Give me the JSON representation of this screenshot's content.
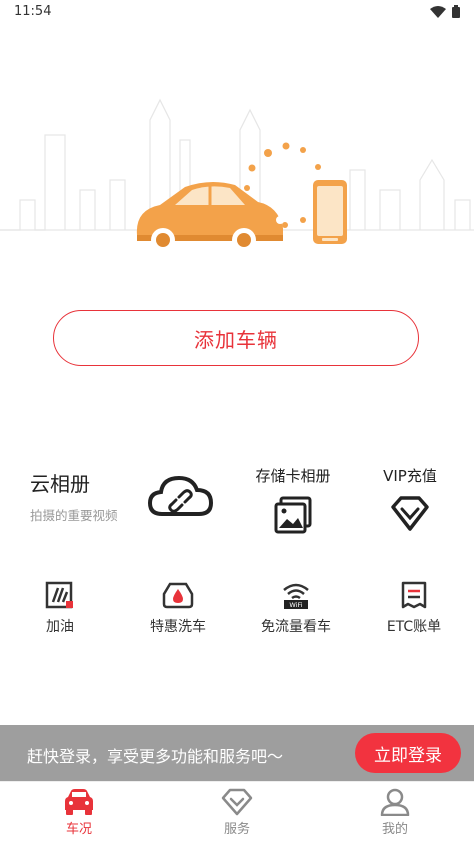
{
  "status_bar": {
    "time": "11:54"
  },
  "hero": {
    "illustration": "car-and-phone-connection"
  },
  "add_car": {
    "label": "添加车辆"
  },
  "cloud_album": {
    "title": "云相册",
    "subtitle": "拍摄的重要视频",
    "icon": "cloud-link-icon"
  },
  "sd_album": {
    "title": "存储卡相册",
    "icon": "photo-gallery-icon"
  },
  "vip": {
    "title": "VIP充值",
    "icon": "diamond-icon"
  },
  "quick_actions": [
    {
      "label": "加油",
      "icon": "fuel-icon"
    },
    {
      "label": "特惠洗车",
      "icon": "car-wash-icon"
    },
    {
      "label": "免流量看车",
      "icon": "wifi-icon"
    },
    {
      "label": "ETC账单",
      "icon": "bill-icon"
    }
  ],
  "login_banner": {
    "text": "赶快登录，享受更多功能和服务吧～",
    "button": "立即登录"
  },
  "tabs": [
    {
      "label": "车况",
      "icon": "car-icon",
      "active": true
    },
    {
      "label": "服务",
      "icon": "diamond-icon",
      "active": false
    },
    {
      "label": "我的",
      "icon": "user-icon",
      "active": false
    }
  ],
  "colors": {
    "accent": "#e8333a",
    "car_orange": "#f3a24a",
    "banner_gray": "#9e9e9e"
  }
}
